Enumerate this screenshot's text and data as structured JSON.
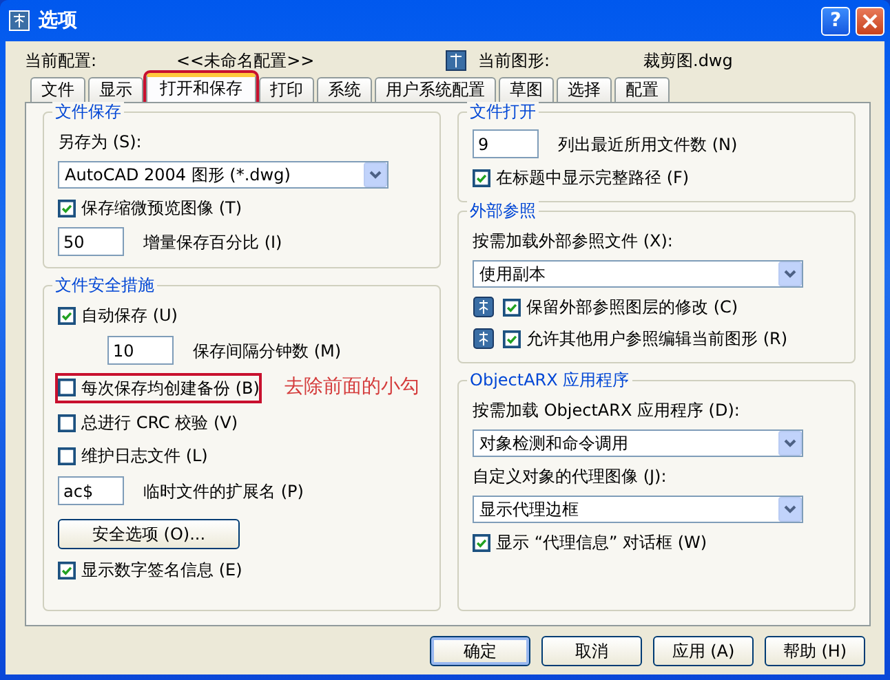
{
  "window": {
    "title": "选项",
    "help_glyph": "?"
  },
  "header": {
    "profile_label": "当前配置:",
    "profile_value": "<<未命名配置>>",
    "drawing_label": "当前图形:",
    "drawing_value": "裁剪图.dwg"
  },
  "tabs": [
    {
      "label": "文件",
      "selected": false,
      "highlighted": false
    },
    {
      "label": "显示",
      "selected": false,
      "highlighted": false
    },
    {
      "label": "打开和保存",
      "selected": true,
      "highlighted": true
    },
    {
      "label": "打印",
      "selected": false,
      "highlighted": false
    },
    {
      "label": "系统",
      "selected": false,
      "highlighted": false
    },
    {
      "label": "用户系统配置",
      "selected": false,
      "highlighted": false
    },
    {
      "label": "草图",
      "selected": false,
      "highlighted": false
    },
    {
      "label": "选择",
      "selected": false,
      "highlighted": false
    },
    {
      "label": "配置",
      "selected": false,
      "highlighted": false
    }
  ],
  "left_groups": [
    {
      "title": "文件保存",
      "items": [
        {
          "kind": "label",
          "text": "另存为 (S):"
        },
        {
          "kind": "select",
          "value": "AutoCAD 2004 图形  (*.dwg)"
        },
        {
          "kind": "checkbox",
          "label": "保存缩微预览图像 (T)",
          "checked": true
        },
        {
          "kind": "field",
          "entry": "50",
          "caption": "增量保存百分比 (I)",
          "indent": false
        }
      ]
    },
    {
      "title": "文件安全措施",
      "items": [
        {
          "kind": "checkbox",
          "label": "自动保存 (U)",
          "checked": true
        },
        {
          "kind": "field",
          "entry": "10",
          "caption": "保存间隔分钟数 (M)",
          "indent": true
        },
        {
          "kind": "checkbox",
          "label": "每次保存均创建备份 (B)",
          "checked": false,
          "highlighted": true,
          "note": "去除前面的小勾"
        },
        {
          "kind": "checkbox",
          "label": "总进行 CRC 校验 (V)",
          "checked": false
        },
        {
          "kind": "checkbox",
          "label": "维护日志文件 (L)",
          "checked": false
        },
        {
          "kind": "field",
          "entry": "ac$",
          "caption": "临时文件的扩展名 (P)",
          "indent": false
        },
        {
          "kind": "button",
          "label": "安全选项 (O)..."
        },
        {
          "kind": "checkbox",
          "label": "显示数字签名信息 (E)",
          "checked": true
        }
      ]
    }
  ],
  "right_groups": [
    {
      "title": "文件打开",
      "items": [
        {
          "kind": "field",
          "entry": "9",
          "caption": "列出最近所用文件数 (N)",
          "indent": false
        },
        {
          "kind": "checkbox",
          "label": "在标题中显示完整路径 (F)",
          "checked": true
        }
      ]
    },
    {
      "title": "外部参照",
      "items": [
        {
          "kind": "label",
          "text": "按需加载外部参照文件 (X):"
        },
        {
          "kind": "select",
          "value": "使用副本"
        },
        {
          "kind": "icon_checkbox",
          "label": "保留外部参照图层的修改 (C)",
          "checked": true
        },
        {
          "kind": "icon_checkbox",
          "label": "允许其他用户参照编辑当前图形 (R)",
          "checked": true
        }
      ]
    },
    {
      "title": "ObjectARX 应用程序",
      "items": [
        {
          "kind": "label",
          "text": "按需加载 ObjectARX 应用程序 (D):"
        },
        {
          "kind": "select",
          "value": "对象检测和命令调用"
        },
        {
          "kind": "label",
          "text": "自定义对象的代理图像 (J):"
        },
        {
          "kind": "select",
          "value": "显示代理边框"
        },
        {
          "kind": "checkbox",
          "label": "显示 “代理信息” 对话框 (W)",
          "checked": true
        }
      ]
    }
  ],
  "buttons": [
    {
      "label": "确定",
      "default": true
    },
    {
      "label": "取消",
      "default": false
    },
    {
      "label": "应用 (A)",
      "default": false
    },
    {
      "label": "帮助 (H)",
      "default": false
    }
  ]
}
